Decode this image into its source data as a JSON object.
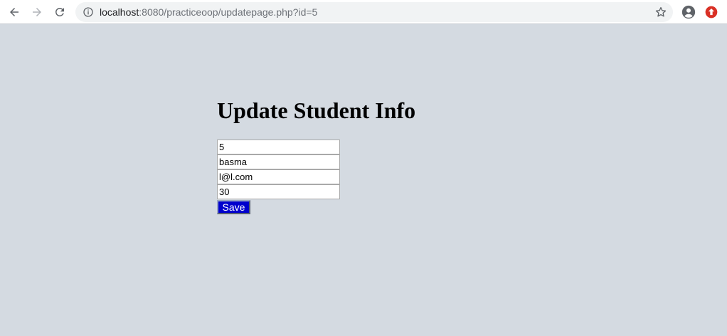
{
  "browser": {
    "url_host": "localhost",
    "url_rest": ":8080/practiceoop/updatepage.php?id=5",
    "icons": {
      "back": "back-arrow-icon",
      "forward": "forward-arrow-icon",
      "reload": "reload-icon",
      "info": "info-icon",
      "bookmark": "star-icon",
      "account": "account-icon",
      "update": "update-icon"
    },
    "colors": {
      "update_badge": "#d93025"
    }
  },
  "page": {
    "title": "Update Student Info",
    "fields": {
      "id": "5",
      "name": "basma",
      "email": "l@l.com",
      "age": "30"
    },
    "save_label": "Save",
    "colors": {
      "background": "#d4dae1",
      "save_button": "#0000cd"
    }
  }
}
